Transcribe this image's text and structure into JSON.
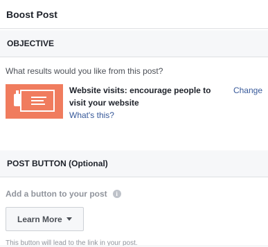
{
  "header": {
    "title": "Boost Post"
  },
  "objective": {
    "section_title": "OBJECTIVE",
    "question": "What results would you like from this post?",
    "selected_title": "Website visits: encourage people to visit your website",
    "whats_this": "What's this?",
    "change": "Change",
    "thumbnail_icon": "website-card-icon",
    "thumbnail_color": "#f07c5e"
  },
  "post_button": {
    "section_title": "POST BUTTON (Optional)",
    "add_label": "Add a button to your post",
    "info_glyph": "i",
    "dropdown_value": "Learn More",
    "hint": "This button will lead to the link in your post."
  },
  "colors": {
    "link": "#365899",
    "section_bg": "#f6f7f9",
    "border": "#dddfe2"
  }
}
